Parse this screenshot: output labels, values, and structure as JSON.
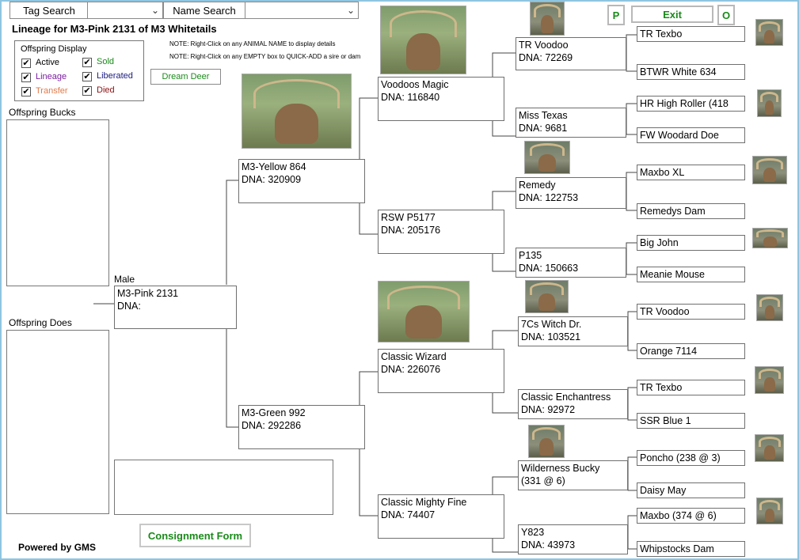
{
  "header": {
    "tag_search_label": "Tag Search",
    "name_search_label": "Name Search",
    "title": "Lineage for M3-Pink 2131 of M3 Whitetails",
    "note1": "NOTE: Right-Click on any ANIMAL NAME to display details",
    "note2": "NOTE: Right-Click on any EMPTY box to QUICK-ADD a sire or dam",
    "p_label": "P",
    "exit_label": "Exit",
    "o_label": "O"
  },
  "offspring_display": {
    "title": "Offspring Display",
    "options": [
      {
        "label": "Active",
        "checked": "✔",
        "color": "#000000"
      },
      {
        "label": "Lineage",
        "checked": "✔",
        "color": "#7a1fa0"
      },
      {
        "label": "Transfer",
        "checked": "✔",
        "color": "#e07a4a"
      },
      {
        "label": "Sold",
        "checked": "✔",
        "color": "#1a8a1a"
      },
      {
        "label": "Liberated",
        "checked": "✔",
        "color": "#1a1a80"
      },
      {
        "label": "Died",
        "checked": "✔",
        "color": "#8b1010"
      }
    ]
  },
  "dream_deer_label": "Dream Deer",
  "offspring_bucks_label": "Offspring Bucks",
  "offspring_does_label": "Offspring Does",
  "consignment_label": "Consignment Form",
  "powered_by": "Powered by GMS",
  "subject": {
    "sex": "Male",
    "name": "M3-Pink 2131",
    "dna": "DNA:"
  },
  "gen1": {
    "sire": {
      "name": "M3-Yellow 864",
      "dna": "DNA: 320909"
    },
    "dam": {
      "name": "M3-Green 992",
      "dna": "DNA: 292286"
    }
  },
  "gen2": [
    {
      "name": "Voodoos Magic",
      "dna": "DNA: 116840"
    },
    {
      "name": "RSW P5177",
      "dna": "DNA: 205176"
    },
    {
      "name": "Classic Wizard",
      "dna": "DNA: 226076"
    },
    {
      "name": "Classic Mighty Fine",
      "dna": "DNA: 74407"
    }
  ],
  "gen3": [
    {
      "name": "TR Voodoo",
      "dna": "DNA: 72269"
    },
    {
      "name": "Miss Texas",
      "dna": "DNA: 9681"
    },
    {
      "name": "Remedy",
      "dna": "DNA: 122753"
    },
    {
      "name": "P135",
      "dna": "DNA: 150663"
    },
    {
      "name": "7Cs Witch Dr.",
      "dna": "DNA: 103521"
    },
    {
      "name": "Classic Enchantress",
      "dna": "DNA: 92972"
    },
    {
      "name": "Wilderness Bucky",
      "dna": "(331 @ 6)"
    },
    {
      "name": "Y823",
      "dna": "DNA: 43973"
    }
  ],
  "gen4": [
    "TR Texbo",
    "BTWR White 634",
    "HR High Roller (418",
    "FW Woodard Doe",
    "Maxbo XL",
    "Remedys Dam",
    "Big John",
    "Meanie Mouse",
    "TR Voodoo",
    "Orange 7114",
    "TR Texbo",
    "SSR Blue 1",
    "Poncho (238 @ 3)",
    "Daisy May",
    "Maxbo (374 @ 6)",
    "Whipstocks Dam"
  ]
}
